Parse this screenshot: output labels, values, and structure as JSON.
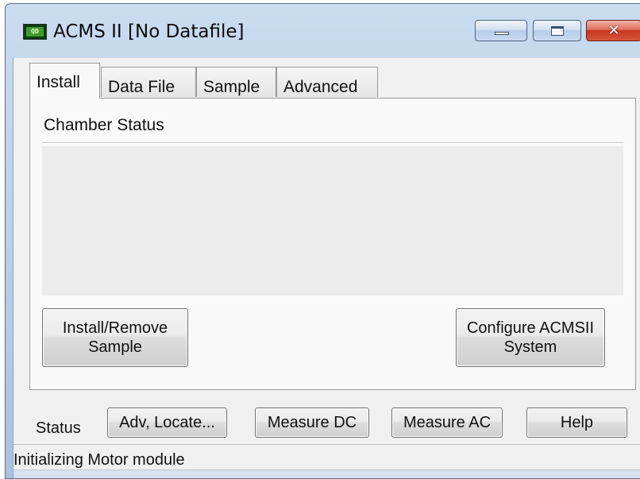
{
  "window": {
    "title": "ACMS II [No Datafile]",
    "app_icon_text": "QD"
  },
  "tabs": [
    {
      "label": "Install",
      "active": true
    },
    {
      "label": "Data File",
      "active": false
    },
    {
      "label": "Sample",
      "active": false
    },
    {
      "label": "Advanced",
      "active": false
    }
  ],
  "install_panel": {
    "chamber_status_label": "Chamber Status",
    "install_remove_line1": "Install/Remove",
    "install_remove_line2": "Sample",
    "configure_line1": "Configure ACMSII",
    "configure_line2": "System"
  },
  "bottom_bar": {
    "status_label": "Status",
    "adv_locate_label": "Adv, Locate...",
    "measure_dc_label": "Measure DC",
    "measure_ac_label": "Measure AC",
    "help_label": "Help"
  },
  "status_bar": {
    "message": "Initializing Motor module"
  },
  "colors": {
    "title_bar": "#b7cde6",
    "close_button": "#c9361f",
    "panel_bg": "#f0f0f0"
  }
}
